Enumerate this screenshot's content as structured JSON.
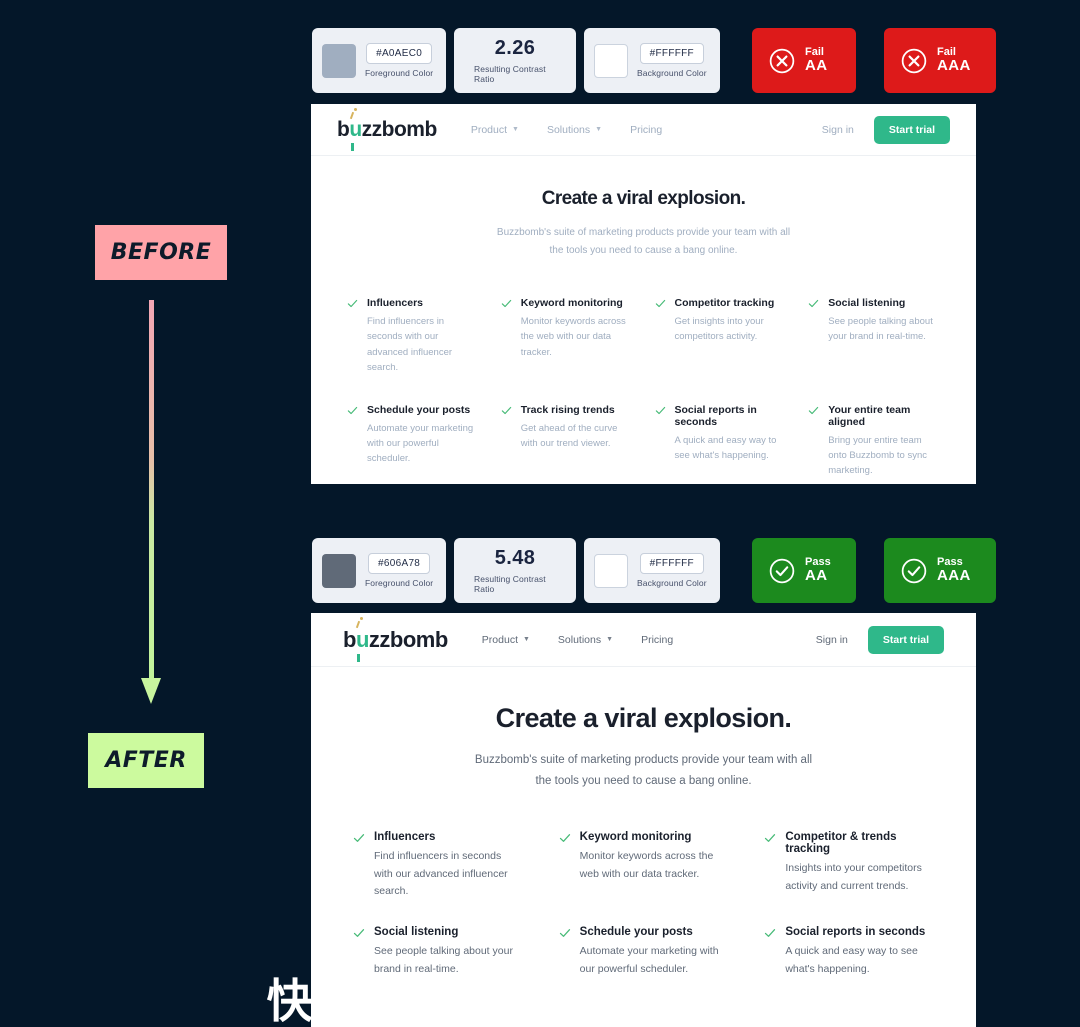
{
  "page": {
    "background_color": "#041729",
    "watermark": "快传号/人人都是产品经理"
  },
  "rail": {
    "before_label": "BEFORE",
    "after_label": "AFTER",
    "before_color": "#ffa3a8",
    "after_color": "#ccfa9e",
    "arrow_gradient_from": "#f3a6b4",
    "arrow_gradient_to": "#c2f59b"
  },
  "before": {
    "contrast": {
      "foreground_hex": "#A0AEC0",
      "foreground_caption": "Foreground Color",
      "ratio_value": "2.26",
      "ratio_caption": "Resulting Contrast Ratio",
      "background_hex": "#FFFFFF",
      "background_caption": "Background Color",
      "badges": [
        {
          "result": "Fail",
          "level": "AA",
          "state": "fail",
          "color": "#dd1a1a"
        },
        {
          "result": "Fail",
          "level": "AAA",
          "state": "fail",
          "color": "#dd1a1a"
        }
      ]
    },
    "nav": {
      "logo": "buzzbomb",
      "links": [
        {
          "label": "Product",
          "has_chevron": true
        },
        {
          "label": "Solutions",
          "has_chevron": true
        },
        {
          "label": "Pricing",
          "has_chevron": false
        }
      ],
      "signin": "Sign in",
      "cta": "Start trial"
    },
    "hero": {
      "heading": "Create a viral explosion.",
      "subheading": "Buzzbomb's suite of marketing products provide your team with all the tools you need to cause a bang online."
    },
    "features": [
      {
        "title": "Influencers",
        "desc": "Find influencers in seconds with our advanced influencer search."
      },
      {
        "title": "Keyword monitoring",
        "desc": "Monitor keywords across the web with our data tracker."
      },
      {
        "title": "Competitor tracking",
        "desc": "Get insights into your competitors activity."
      },
      {
        "title": "Social listening",
        "desc": "See people talking about your brand in real-time."
      },
      {
        "title": "Schedule your posts",
        "desc": "Automate your marketing with our powerful scheduler."
      },
      {
        "title": "Track rising trends",
        "desc": "Get ahead of the curve with our trend viewer."
      },
      {
        "title": "Social reports in seconds",
        "desc": "A quick and easy way to see what's happening."
      },
      {
        "title": "Your entire team aligned",
        "desc": "Bring your entire team onto Buzzbomb to sync marketing."
      }
    ]
  },
  "after": {
    "contrast": {
      "foreground_hex": "#606A78",
      "foreground_caption": "Foreground Color",
      "ratio_value": "5.48",
      "ratio_caption": "Resulting Contrast Ratio",
      "background_hex": "#FFFFFF",
      "background_caption": "Background Color",
      "badges": [
        {
          "result": "Pass",
          "level": "AA",
          "state": "pass",
          "color": "#1c8a1e"
        },
        {
          "result": "Pass",
          "level": "AAA",
          "state": "pass",
          "color": "#1c8a1e"
        }
      ]
    },
    "nav": {
      "logo": "buzzbomb",
      "links": [
        {
          "label": "Product",
          "has_chevron": true
        },
        {
          "label": "Solutions",
          "has_chevron": true
        },
        {
          "label": "Pricing",
          "has_chevron": false
        }
      ],
      "signin": "Sign in",
      "cta": "Start trial"
    },
    "hero": {
      "heading": "Create a viral explosion.",
      "subheading": "Buzzbomb's suite of marketing products provide your team with all the tools you need to cause a bang online."
    },
    "features": [
      {
        "title": "Influencers",
        "desc": "Find influencers in seconds with our advanced influencer search."
      },
      {
        "title": "Keyword monitoring",
        "desc": "Monitor keywords across the web with our data tracker."
      },
      {
        "title": "Competitor & trends tracking",
        "desc": "Insights into your competitors activity and current trends."
      },
      {
        "title": "Social listening",
        "desc": "See people talking about your brand in real-time."
      },
      {
        "title": "Schedule your posts",
        "desc": "Automate your marketing with our powerful scheduler."
      },
      {
        "title": "Social reports in seconds",
        "desc": "A quick and easy way to see what's happening."
      }
    ]
  }
}
